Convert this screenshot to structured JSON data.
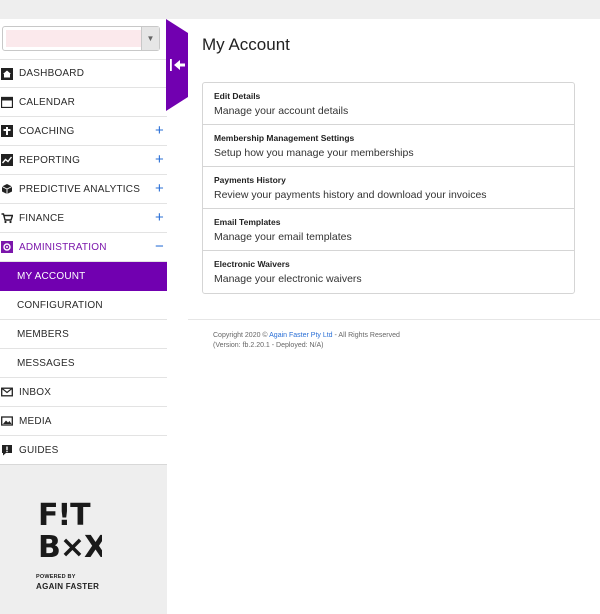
{
  "colors": {
    "accent": "#7100b0",
    "link": "#2a6fd6",
    "sidebar_bg_footer": "#eeeeee"
  },
  "sidebar": {
    "items": [
      {
        "label": "DASHBOARD",
        "icon": "home-icon"
      },
      {
        "label": "CALENDAR",
        "icon": "calendar-icon"
      },
      {
        "label": "COACHING",
        "icon": "coaching-icon",
        "expand": "+"
      },
      {
        "label": "REPORTING",
        "icon": "chart-icon",
        "expand": "+"
      },
      {
        "label": "PREDICTIVE ANALYTICS",
        "icon": "cube-icon",
        "expand": "+"
      },
      {
        "label": "FINANCE",
        "icon": "cart-icon",
        "expand": "+"
      },
      {
        "label": "ADMINISTRATION",
        "icon": "gear-icon",
        "expand": "−"
      },
      {
        "label": "MY ACCOUNT"
      },
      {
        "label": "CONFIGURATION"
      },
      {
        "label": "MEMBERS"
      },
      {
        "label": "MESSAGES"
      },
      {
        "label": "INBOX",
        "icon": "envelope-icon"
      },
      {
        "label": "MEDIA",
        "icon": "image-icon"
      },
      {
        "label": "GUIDES",
        "icon": "guide-icon"
      }
    ],
    "powered_by": "POWERED BY",
    "brand": "AGAIN FASTER",
    "logo_text": "F!T B×X"
  },
  "main": {
    "title": "My Account",
    "cards": [
      {
        "title": "Edit Details",
        "desc": "Manage your account details"
      },
      {
        "title": "Membership Management Settings",
        "desc": "Setup how you manage your memberships"
      },
      {
        "title": "Payments History",
        "desc": "Review your payments history and download your invoices"
      },
      {
        "title": "Email Templates",
        "desc": "Manage your email templates"
      },
      {
        "title": "Electronic Waivers",
        "desc": "Manage your electronic waivers"
      }
    ]
  },
  "footer": {
    "copyright_prefix": "Copyright 2020 © ",
    "company": "Again Faster Pty Ltd",
    "copyright_suffix": " - All Rights Reserved",
    "version": "(Version: fb.2.20.1 - Deployed: N/A)"
  }
}
